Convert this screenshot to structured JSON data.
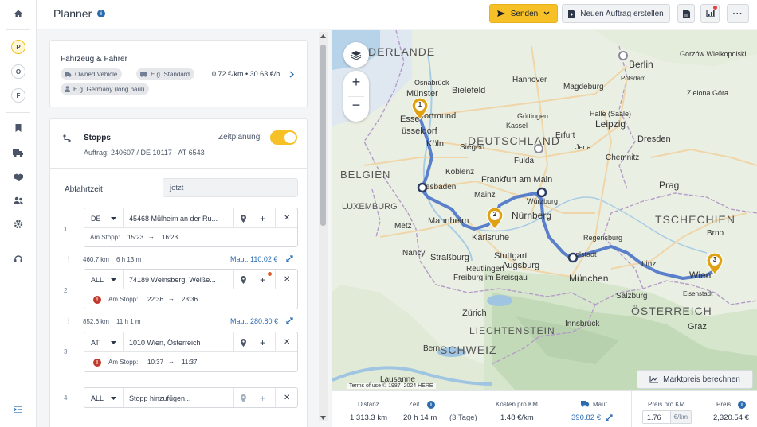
{
  "sidebar": {
    "circles": [
      "P",
      "O",
      "F"
    ]
  },
  "header": {
    "title": "Planner",
    "send_label": "Senden",
    "new_order_label": "Neuen Auftrag erstellen"
  },
  "vehicle": {
    "title": "Fahrzeug & Fahrer",
    "vehicle_chip": "Owned Vehicle",
    "standard_chip": "E.g. Standard",
    "rates": "0.72 €/km • 30.63 €/h",
    "driver_chip": "E.g. Germany (long haul)"
  },
  "stops": {
    "title": "Stopps",
    "order": "Auftrag: 240607 / DE 10117 - AT 6543",
    "time_planning_label": "Zeitplanung",
    "departure_label": "Abfahrtzeit",
    "departure_value": "jetzt",
    "list": [
      {
        "num": "1",
        "country": "DE",
        "address": "45468 Mülheim an der Ru...",
        "at_stop_label": "Am Stopp:",
        "from": "15:23",
        "to": "16:23"
      },
      {
        "num": "2",
        "country": "ALL",
        "address": "74189 Weinsberg, Weiße...",
        "at_stop_label": "Am Stopp:",
        "from": "22:36",
        "to": "23:36"
      },
      {
        "num": "3",
        "country": "AT",
        "address": "1010 Wien, Österreich",
        "at_stop_label": "Am Stopp:",
        "from": "10:37",
        "to": "11:37"
      },
      {
        "num": "4",
        "country": "ALL",
        "address": "Stopp hinzufügen..."
      }
    ],
    "legs": [
      {
        "distance": "460.7 km",
        "duration": "6 h 13 m",
        "toll": "Maut: 110.02 €"
      },
      {
        "distance": "852.6 km",
        "duration": "11 h 1 m",
        "toll": "Maut: 280.80 €"
      }
    ]
  },
  "map": {
    "attribution": "Terms of use   © 1987–2024 HERE",
    "market_button": "Marktpreis berechnen",
    "markers": [
      "1",
      "2",
      "3"
    ],
    "labels": {
      "niederlande": "DERLANDE",
      "deutschland": "DEUTSCHLAND",
      "belgien": "BELGIEN",
      "luxemburg": "LUXEMBURG",
      "tschechien": "TSCHECHIEN",
      "oesterreich": "ÖSTERREICH",
      "schweiz": "SCHWEIZ",
      "liechtenstein": "LIECHTENSTEIN",
      "berlin": "Berlin",
      "hannover": "Hannover",
      "bielefeld": "Bielefeld",
      "dortmund": "Dortmund",
      "essen": "Esse",
      "duesseldorf": "üsseldorf",
      "koeln": "Köln",
      "frankfurt": "Frankfurt am Main",
      "nuernberg": "Nürnberg",
      "muenchen": "München",
      "stuttgart": "Stuttgart",
      "karlsruhe": "Karlsruhe",
      "mannheim": "Mannheim",
      "leipzig": "Leipzig",
      "dresden": "Dresden",
      "prag": "Prag",
      "wien": "Wien",
      "muenster": "Münster",
      "wiesbaden": "esbaden",
      "kassel": "Kassel",
      "goettingen": "Göttingen",
      "augsburg": "Augsburg",
      "regensburg": "Regensburg",
      "salzburg": "Salzburg",
      "innsbruck": "Innsbruck",
      "zuerich": "Zürich",
      "strassburg": "Straßburg",
      "freiburg": "Freiburg im Breisgau",
      "bern": "Bern",
      "lausanne": "Lausanne",
      "brno": "Brno",
      "graz": "Graz",
      "halle": "Halle (Saale)",
      "magdeburg": "Magdeburg",
      "potsdam": "Potsdam",
      "wuerzburg": "Würzburg",
      "mainz": "Mainz",
      "koblenz": "Koblenz",
      "nancy": "Nancy",
      "metz": "Metz",
      "reutlingen": "Reutlingen",
      "ingolstadt": "olstadt",
      "osnabrueck": "Osnabrück",
      "siegen": "Siegen",
      "erfurt": "Erfurt",
      "jena": "Jena",
      "chemnitz": "Chemnitz",
      "fulda": "Fulda",
      "gorzow": "Gorzów Wielkopolski",
      "zielona": "Zielona Góra",
      "bruenn": "Brno",
      "eisenstadt": "Eisenstadt",
      "linz": "Linz"
    }
  },
  "summary": {
    "distance_label": "Distanz",
    "distance_value": "1,313.3 km",
    "time_label": "Zeit",
    "time_value": "20 h 14 m",
    "time_days": "(3 Tage)",
    "cost_label": "Kosten pro KM",
    "cost_value": "1.48 €/km",
    "toll_label": "Maut",
    "toll_value": "390.82 €",
    "price_km_label": "Preis pro KM",
    "price_km_value": "1.76",
    "price_km_unit": "€/km",
    "price_label": "Preis",
    "price_value": "2,320.54 €"
  },
  "colors": {
    "accent": "#f6c026",
    "route": "#4a72c8",
    "link": "#2b6cb0",
    "warning": "#c0392b"
  }
}
